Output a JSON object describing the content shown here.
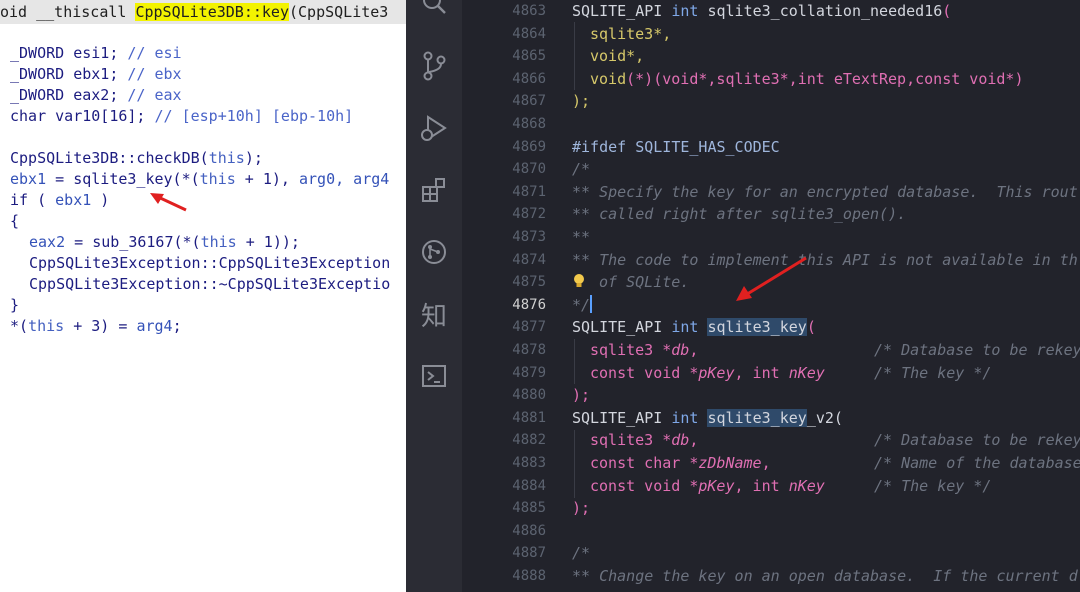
{
  "left": {
    "header": {
      "prefix": "oid __thiscall ",
      "func_class": "CppSQLite3DB",
      "func_sep": "::",
      "func_name": "key",
      "suffix": "(CppSQLite3"
    },
    "lines": [
      {
        "a": "_DWORD esi1; ",
        "b": "// esi"
      },
      {
        "a": "_DWORD ebx1; ",
        "b": "// ebx"
      },
      {
        "a": "_DWORD eax2; ",
        "b": "// eax"
      },
      {
        "a": "char var10[16]; ",
        "b": "// [esp+10h] [ebp-10h]"
      }
    ],
    "body": {
      "l1_a": "CppSQLite3DB::checkDB(",
      "l1_this": "this",
      "l1_b": ");",
      "l2_var": "ebx1",
      "l2_a": " = sqlite3_key(*(",
      "l2_this": "this",
      "l2_b": " + 1), ",
      "l2_arg": "arg0, arg4",
      "l3_a": "if ( ",
      "l3_var": "ebx1",
      "l3_b": " )",
      "l4": "{",
      "l5_var": "eax2",
      "l5_a": " = sub_36167(*(",
      "l5_this": "this",
      "l5_b": " + 1));",
      "l6": "CppSQLite3Exception::CppSQLite3Exception",
      "l7": "CppSQLite3Exception::~CppSQLite3Exceptio",
      "l8": "}",
      "l9_a": "*(",
      "l9_this": "this",
      "l9_b": " + 3) = ",
      "l9_arg": "arg4",
      "l9_c": ";"
    }
  },
  "activity_bar": {
    "icons": [
      "search-icon",
      "source-control-icon",
      "run-debug-icon",
      "extensions-icon",
      "remote-explorer-icon",
      "zhihu-icon",
      "terminal-icon"
    ],
    "zhihu_glyph": "知"
  },
  "editor": {
    "line_numbers": [
      "4863",
      "4864",
      "4865",
      "4866",
      "4867",
      "4868",
      "4869",
      "4870",
      "4871",
      "4872",
      "4873",
      "4874",
      "4875",
      "4876",
      "4877",
      "4878",
      "4879",
      "4880",
      "4881",
      "4882",
      "4883",
      "4884",
      "4885",
      "4886",
      "4887",
      "4888"
    ],
    "active_line": "4876",
    "code": {
      "l4863_a": "SQLITE_API ",
      "l4863_b": "int",
      "l4863_c": " sqlite3_collation_needed16",
      "l4863_d": "(",
      "l4864": "sqlite3*,",
      "l4865": "void*,",
      "l4866_a": "void",
      "l4866_b": "(*)(",
      "l4866_c": "void*,sqlite3*,int ",
      "l4866_d": "eTextRep",
      "l4866_e": ",const void*)",
      "l4867": ");",
      "l4869_a": "#ifdef ",
      "l4869_b": "SQLITE_HAS_CODEC",
      "l4870": "/*",
      "l4871": "** Specify the key for an encrypted database.  This rout",
      "l4872": "** called right after sqlite3_open().",
      "l4873": "**",
      "l4874": "** The code to implement this API is not available in th",
      "l4875": " of SQLite.",
      "l4876": "*/",
      "l4877_a": "SQLITE_API ",
      "l4877_b": "int",
      "l4877_c": "sqlite3_key",
      "l4877_d": "(",
      "l4878_a": "sqlite3 *",
      "l4878_b": "db",
      "l4878_c": ",",
      "l4878_d": "/* Database to be rekey",
      "l4879_a": "const void *",
      "l4879_b": "pKey",
      "l4879_c": ", int ",
      "l4879_d": "nKey",
      "l4879_e": "/* The key */",
      "l4880": ");",
      "l4881_a": "SQLITE_API ",
      "l4881_b": "int",
      "l4881_c": "sqlite3_key",
      "l4881_d": "_v2(",
      "l4882_a": "sqlite3 *",
      "l4882_b": "db",
      "l4882_c": ",",
      "l4882_d": "/* Database to be rekey",
      "l4883_a": "const char *",
      "l4883_b": "zDbName",
      "l4883_c": ",",
      "l4883_d": "/* Name of the database",
      "l4884_a": "const void *",
      "l4884_b": "pKey",
      "l4884_c": ", int ",
      "l4884_d": "nKey",
      "l4884_e": "/* The key */",
      "l4885": ");",
      "l4887": "/*",
      "l4888": "** Change the key on an open database.  If the current d"
    }
  },
  "colors": {
    "arrow": "#e02020",
    "left_highlight": "#f3f300",
    "editor_bg": "#22232b",
    "selection": "#2f4a6a"
  }
}
